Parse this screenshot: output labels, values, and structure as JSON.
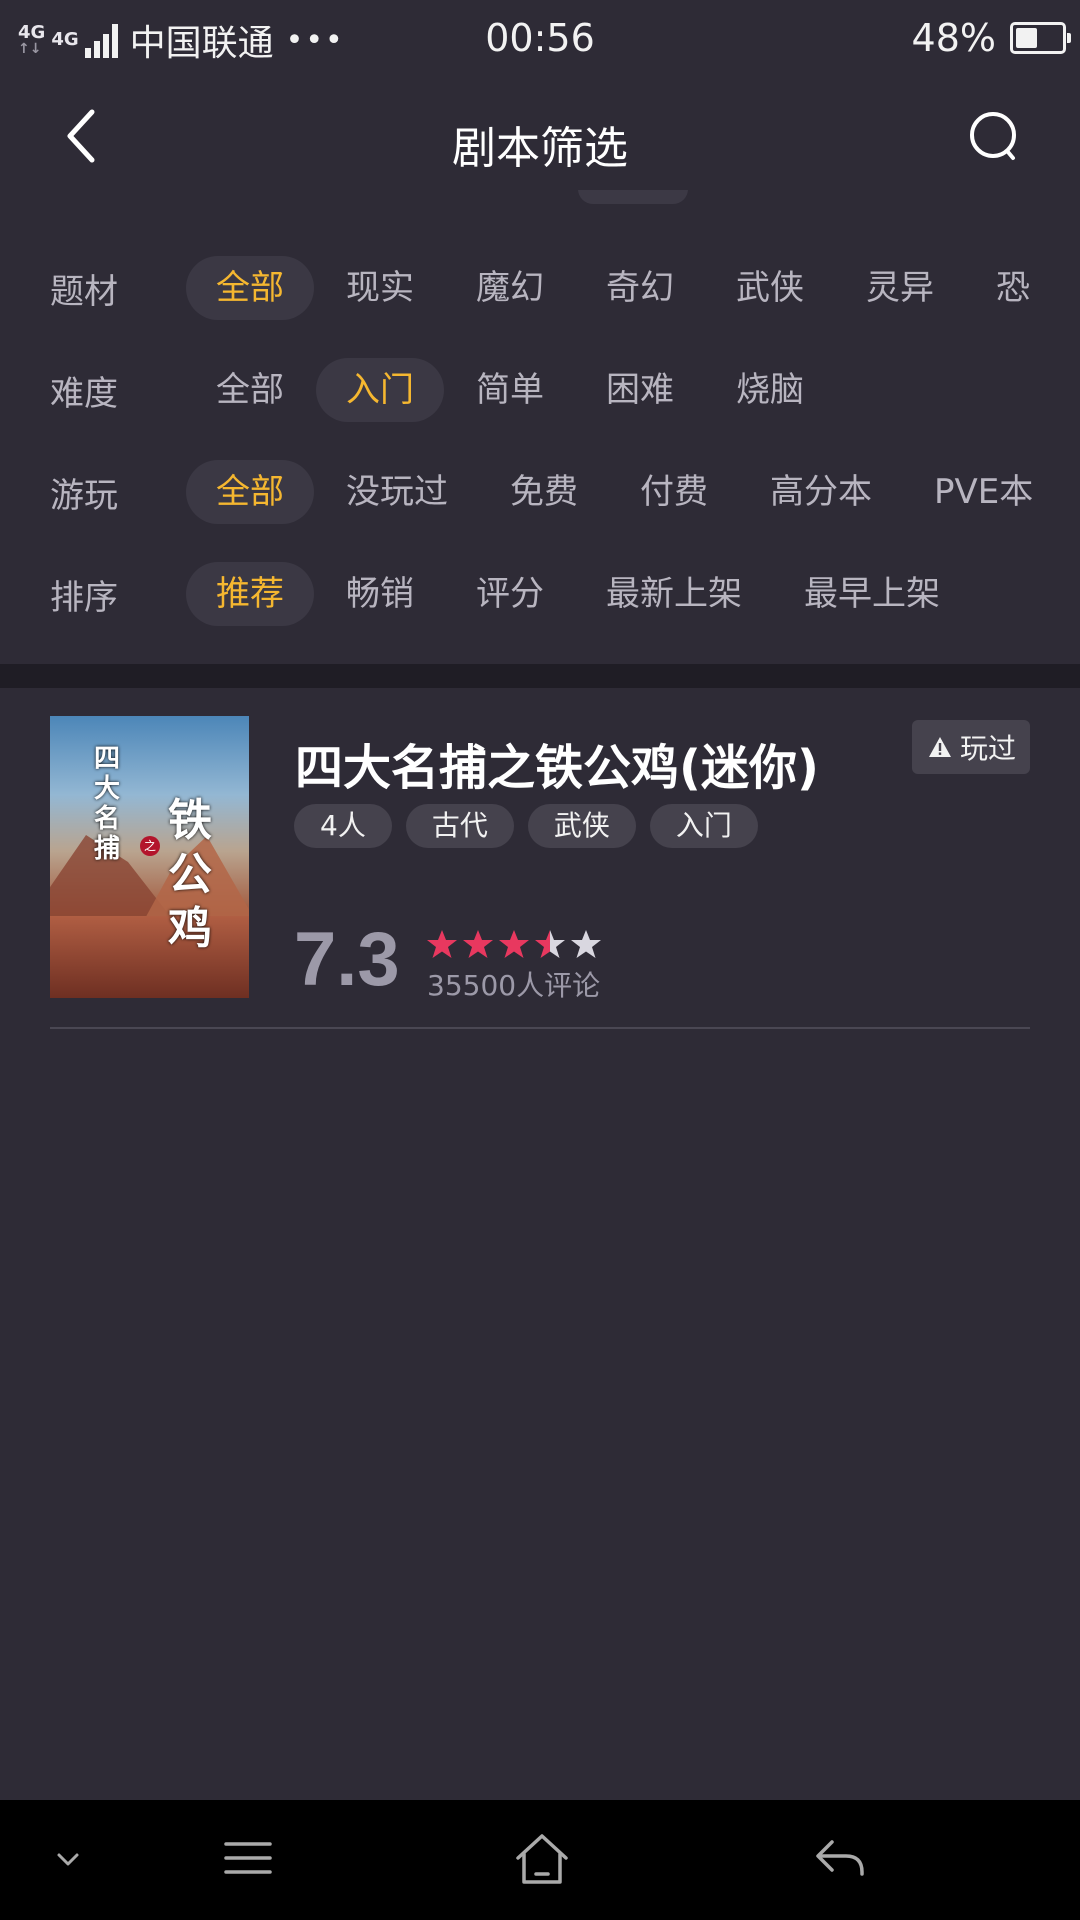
{
  "status_bar": {
    "network_type_1": "4G",
    "network_type_2": "4G",
    "carrier": "中国联通",
    "more_dots": "•••",
    "time": "00:56",
    "battery_percent": "48%",
    "battery_level": 0.48
  },
  "header": {
    "title": "剧本筛选",
    "back_icon": "chevron-left-icon",
    "search_icon": "search-icon"
  },
  "filters": [
    {
      "label": "题材",
      "options": [
        "全部",
        "现实",
        "魔幻",
        "奇幻",
        "武侠",
        "灵异",
        "恐"
      ],
      "selected": "全部"
    },
    {
      "label": "难度",
      "options": [
        "全部",
        "入门",
        "简单",
        "困难",
        "烧脑"
      ],
      "selected": "入门"
    },
    {
      "label": "游玩",
      "options": [
        "全部",
        "没玩过",
        "免费",
        "付费",
        "高分本",
        "PVE本"
      ],
      "selected": "全部"
    },
    {
      "label": "排序",
      "options": [
        "推荐",
        "畅销",
        "评分",
        "最新上架",
        "最早上架"
      ],
      "selected": "推荐"
    }
  ],
  "colors": {
    "background": "#2e2b36",
    "accent_selected": "#f5b730",
    "star_filled": "#e8385f",
    "star_empty": "#d9d7e0"
  },
  "script_card": {
    "title": "四大名捕之铁公鸡(迷你)",
    "played_label": "玩过",
    "played_icon": "warning-icon",
    "tags": [
      "4人",
      "古代",
      "武侠",
      "入门"
    ],
    "score": "7.3",
    "rating_stars": 3.5,
    "rating_max": 5,
    "reviews": "35500人评论",
    "cover": {
      "text_top": "四大名捕",
      "text_seal": "之",
      "text_main": "铁公鸡"
    }
  },
  "nav_bar": {
    "icons": [
      "chevron-down-icon",
      "menu-icon",
      "home-icon",
      "back-arrow-icon"
    ]
  }
}
